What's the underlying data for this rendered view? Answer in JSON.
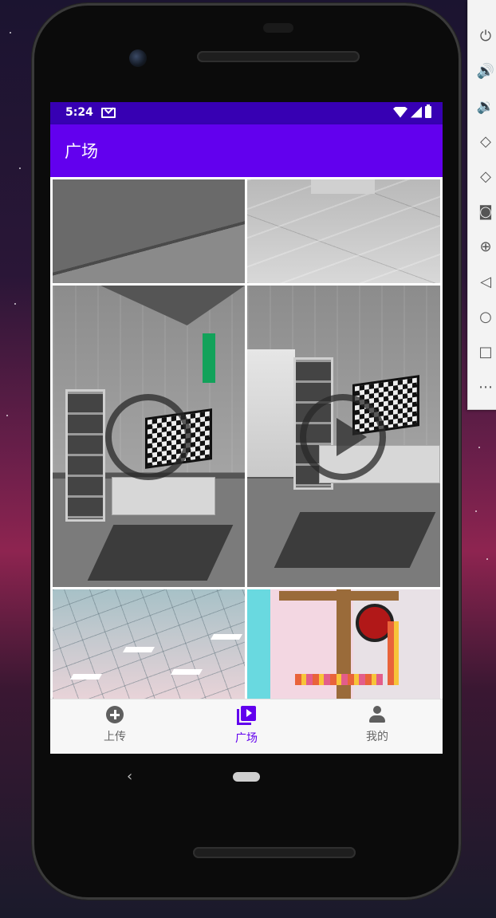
{
  "statusbar": {
    "time": "5:24"
  },
  "appbar": {
    "title": "广场"
  },
  "grid": {
    "tiles": [
      {
        "kind": "floor-dark",
        "video": false
      },
      {
        "kind": "floor-light",
        "video": false
      },
      {
        "kind": "room-1",
        "video": true
      },
      {
        "kind": "room-2",
        "video": true
      },
      {
        "kind": "ceiling",
        "video": false
      },
      {
        "kind": "shop",
        "video": false
      }
    ]
  },
  "bottom_nav": {
    "items": [
      {
        "label": "上传",
        "icon": "add-circle-icon",
        "active": false
      },
      {
        "label": "广场",
        "icon": "video-library-icon",
        "active": true
      },
      {
        "label": "我的",
        "icon": "person-icon",
        "active": false
      }
    ]
  },
  "system_nav": {
    "back_symbol": "‹"
  },
  "emulator_toolbar": {
    "tools": [
      "power-icon",
      "volume-up-icon",
      "volume-down-icon",
      "rotate-left-icon",
      "rotate-right-icon",
      "camera-icon",
      "zoom-icon",
      "back-icon",
      "home-icon",
      "overview-icon",
      "more-icon"
    ]
  },
  "colors": {
    "primary": "#6200ee",
    "primary_dark": "#3700b3",
    "nav_inactive": "#666666"
  }
}
